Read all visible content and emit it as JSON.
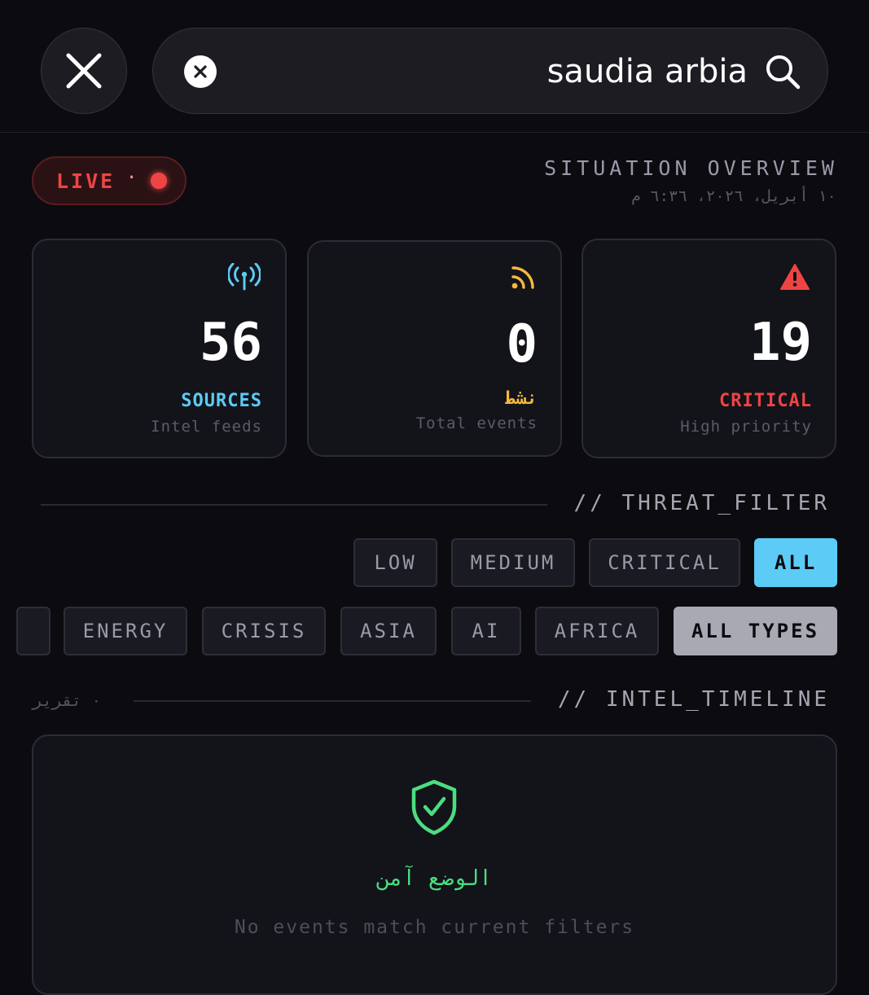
{
  "search": {
    "query": "saudia arbia"
  },
  "header": {
    "live_label": "LIVE",
    "live_separator": "·",
    "title": "SITUATION OVERVIEW",
    "datetime": "١٠ أبريل، ٢٠٢٦، ٦:٣٦ م"
  },
  "stats": [
    {
      "icon": "antenna-icon",
      "value": "56",
      "label": "SOURCES",
      "sublabel": "Intel feeds",
      "color": "#5ccbf5"
    },
    {
      "icon": "rss-icon",
      "value": "0",
      "label": "نشط",
      "sublabel": "Total events",
      "color": "#f5b93d"
    },
    {
      "icon": "warning-icon",
      "value": "19",
      "label": "CRITICAL",
      "sublabel": "High priority",
      "color": "#ef4444"
    }
  ],
  "threat_filter": {
    "header": "// THREAT_FILTER",
    "options": [
      "LOW",
      "MEDIUM",
      "CRITICAL",
      "ALL"
    ],
    "selected": "ALL"
  },
  "type_filter": {
    "options": [
      "ENERGY",
      "CRISIS",
      "ASIA",
      "AI",
      "AFRICA",
      "ALL TYPES"
    ],
    "selected": "ALL TYPES"
  },
  "timeline": {
    "header": "// INTEL_TIMELINE",
    "report_count": "٠ تقرير",
    "empty_title": "الوضع آمن",
    "empty_subtitle": "No events match current filters"
  },
  "colors": {
    "accent": "#5ccbf5",
    "danger": "#ef4444",
    "safe": "#4ade80",
    "warning": "#f5b93d"
  }
}
